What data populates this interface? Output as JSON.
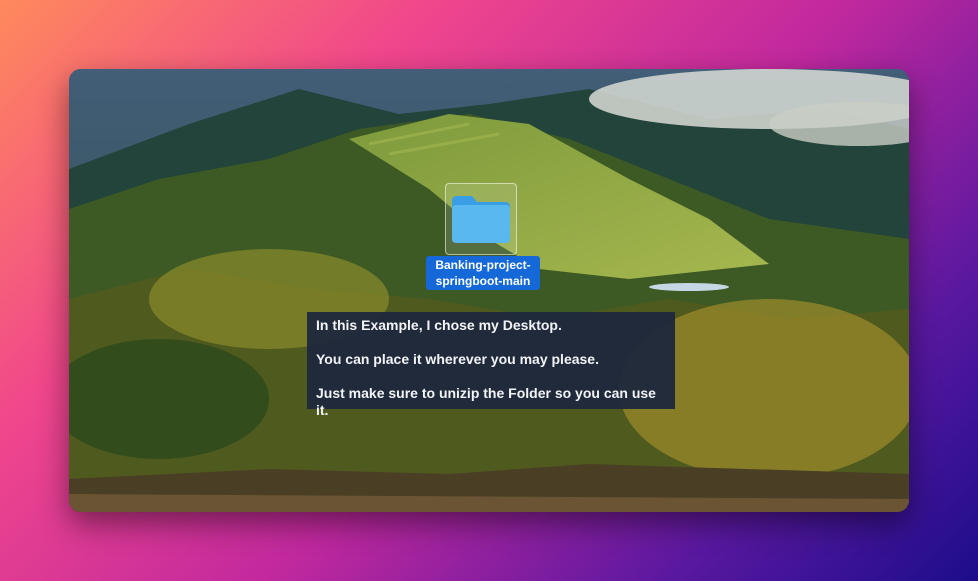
{
  "desktop": {
    "folder": {
      "icon": "folder-icon",
      "label": "Banking-project-springboot-main",
      "label_color": "#1468d8",
      "folder_color": "#5ab8f0"
    },
    "tooltip": {
      "lines": [
        "In this Example, I chose my Desktop.",
        "You can place it wherever you may please.",
        "Just make sure to unizip the Folder so you can use it."
      ]
    }
  }
}
